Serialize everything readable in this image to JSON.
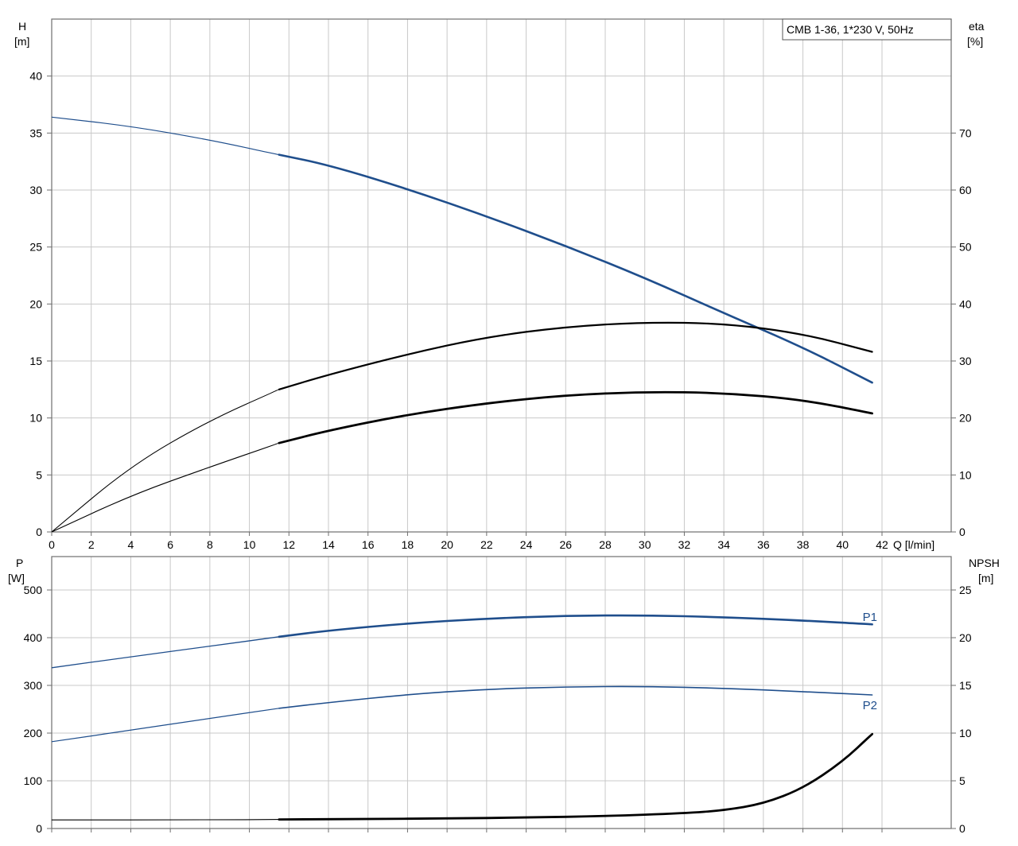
{
  "chart_data": [
    {
      "type": "line",
      "title": "CMB 1-36, 1*230 V, 50Hz",
      "xlabel": "Q [l/min]",
      "xlim": [
        0,
        45.5
      ],
      "xticks": [
        0,
        2,
        4,
        6,
        8,
        10,
        12,
        14,
        16,
        18,
        20,
        22,
        24,
        26,
        28,
        30,
        32,
        34,
        36,
        38,
        40,
        42
      ],
      "y_left": {
        "label_top": "H",
        "label_unit": "[m]",
        "ylim": [
          0,
          45
        ],
        "ticks": [
          0,
          5,
          10,
          15,
          20,
          25,
          30,
          35,
          40
        ]
      },
      "y_right": {
        "label_top": "eta",
        "label_unit": "[%]",
        "ylim": [
          0,
          90
        ],
        "ticks": [
          0,
          10,
          20,
          30,
          40,
          50,
          60,
          70
        ]
      },
      "grid": true,
      "series": [
        {
          "axis": "left",
          "color": "#1f4e8c",
          "x": [
            0,
            4,
            8,
            11.5,
            14,
            18,
            22,
            26,
            30,
            34,
            38,
            41.5
          ],
          "y": [
            36.4,
            35.6,
            34.4,
            33.1,
            32.2,
            30.1,
            27.7,
            25.1,
            22.3,
            19.2,
            16.2,
            13.1
          ]
        },
        {
          "axis": "left",
          "color": "#000000",
          "x": [
            0,
            4,
            8,
            11.5,
            14,
            18,
            22,
            26,
            30,
            34,
            38,
            41.5
          ],
          "y": [
            0,
            5.8,
            9.8,
            12.5,
            13.8,
            15.6,
            17.1,
            18.0,
            18.4,
            18.3,
            17.4,
            15.8
          ]
        },
        {
          "axis": "left",
          "color": "#000000",
          "x": [
            0,
            4,
            8,
            11.5,
            14,
            18,
            22,
            26,
            30,
            34,
            38,
            41.5
          ],
          "y": [
            0,
            3.2,
            5.7,
            7.8,
            8.9,
            10.3,
            11.3,
            12.0,
            12.3,
            12.2,
            11.6,
            10.4
          ]
        }
      ]
    },
    {
      "type": "line",
      "xlim": [
        0,
        45.5
      ],
      "xticks": [
        0,
        2,
        4,
        6,
        8,
        10,
        12,
        14,
        16,
        18,
        20,
        22,
        24,
        26,
        28,
        30,
        32,
        34,
        36,
        38,
        40,
        42
      ],
      "y_left": {
        "label_top": "P",
        "label_unit": "[W]",
        "ylim": [
          0,
          570
        ],
        "ticks": [
          0,
          100,
          200,
          300,
          400,
          500
        ]
      },
      "y_right": {
        "label_top": "NPSH",
        "label_unit": "[m]",
        "ylim": [
          0,
          28.5
        ],
        "ticks": [
          0,
          5,
          10,
          15,
          20,
          25
        ]
      },
      "grid": true,
      "series": [
        {
          "name": "P1",
          "axis": "left",
          "color": "#1f4e8c",
          "x": [
            0,
            4,
            8,
            11.5,
            14,
            18,
            22,
            26,
            30,
            34,
            38,
            41.5
          ],
          "y": [
            337,
            360,
            382,
            402,
            415,
            430,
            440,
            446,
            447,
            443,
            436,
            428
          ]
        },
        {
          "name": "P2",
          "axis": "left",
          "color": "#1f4e8c",
          "x": [
            0,
            4,
            8,
            11.5,
            14,
            18,
            22,
            26,
            30,
            34,
            38,
            41.5
          ],
          "y": [
            182,
            206,
            231,
            252,
            264,
            281,
            292,
            297,
            298,
            294,
            287,
            280
          ]
        },
        {
          "axis": "right",
          "color": "#000000",
          "x": [
            0,
            8,
            11.5,
            16,
            20,
            24,
            28,
            32,
            34,
            36,
            38,
            40,
            41.5
          ],
          "y": [
            0.9,
            0.9,
            0.95,
            1.0,
            1.05,
            1.15,
            1.3,
            1.6,
            1.9,
            2.6,
            4.2,
            7.0,
            9.9
          ]
        }
      ]
    }
  ],
  "colors": {
    "blue_curve": "#1f4e8c",
    "black_curve": "#000000",
    "grid": "#c8c8c8"
  }
}
